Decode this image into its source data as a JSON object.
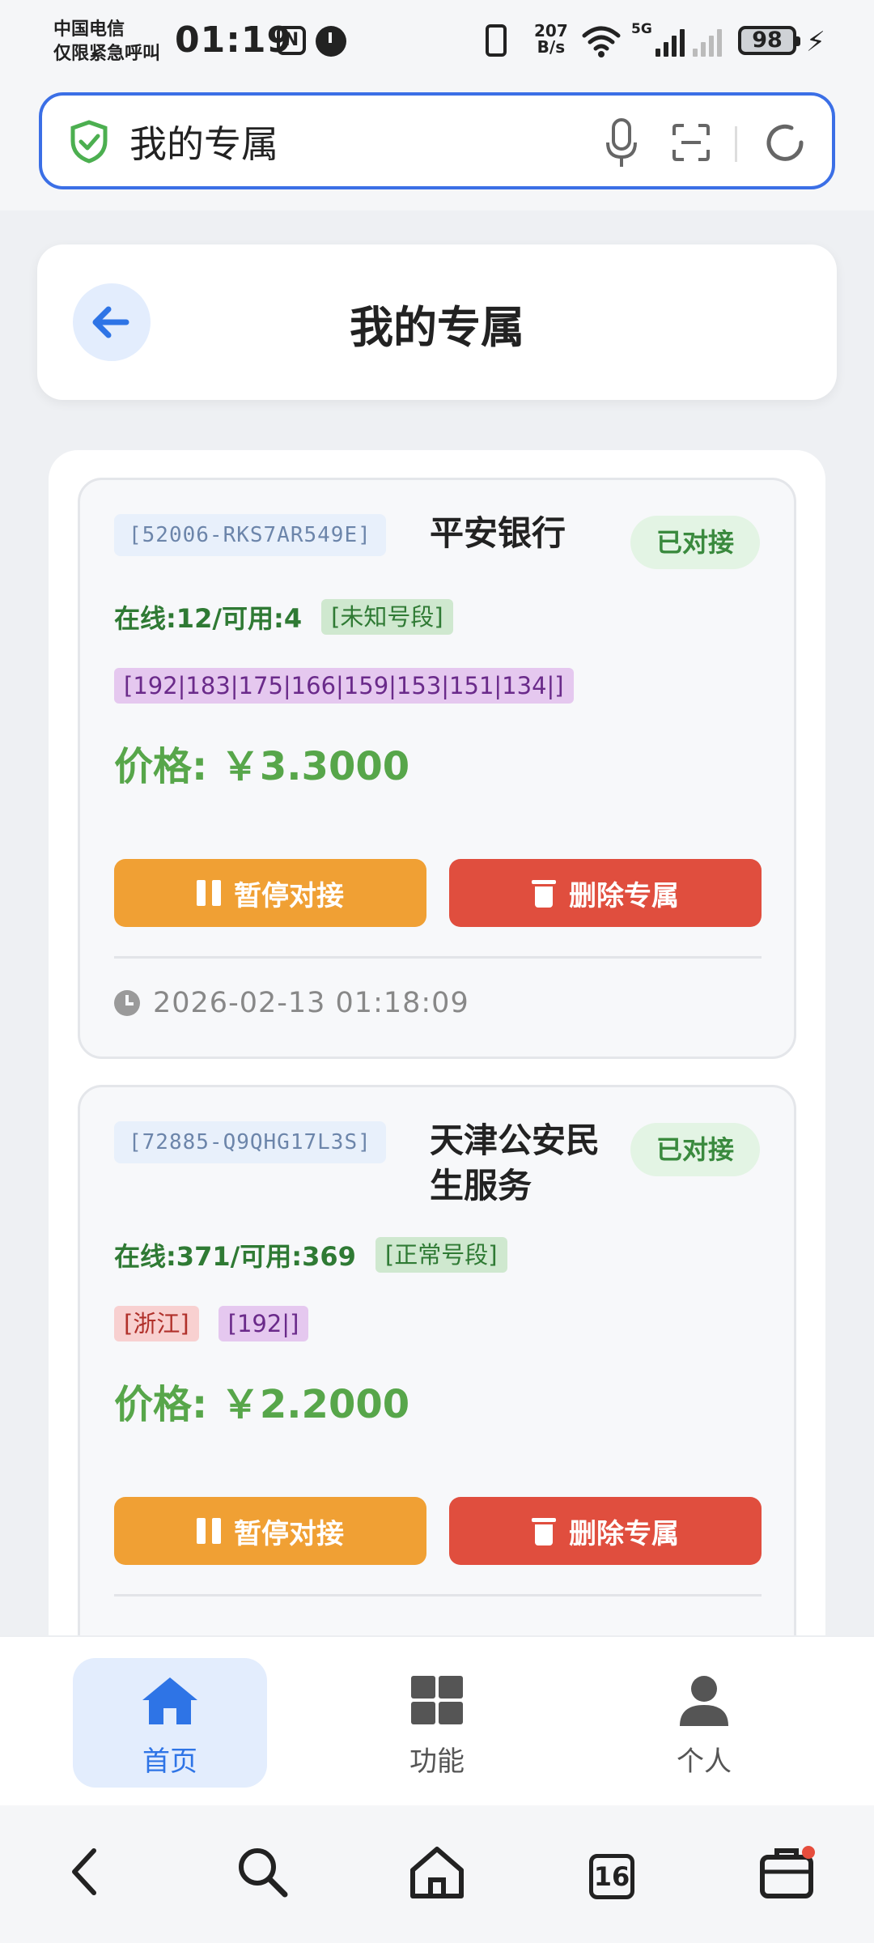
{
  "status_bar": {
    "carrier_line1": "中国电信",
    "carrier_line2": "仅限紧急呼叫",
    "time": "01:19",
    "net_speed_top": "207",
    "net_speed_bottom": "B/s",
    "network_label": "5G",
    "battery": "98"
  },
  "browser": {
    "address_text": "我的专属",
    "tab_count": "16"
  },
  "page": {
    "title": "我的专属"
  },
  "items": [
    {
      "code": "[52006-RKS7AR549E]",
      "name": "平安银行",
      "status": "已对接",
      "stats": "在线:12/可用:4",
      "segment": "[未知号段]",
      "tags_red": [],
      "tags_purple": [
        "[192|183|175|166|159|153|151|134|]"
      ],
      "price": "价格: ￥3.3000",
      "pause_label": "暂停对接",
      "delete_label": "删除专属",
      "time": "2026-02-13 01:18:09"
    },
    {
      "code": "[72885-Q9QHG17L3S]",
      "name": "天津公安民生服务",
      "status": "已对接",
      "stats": "在线:371/可用:369",
      "segment": "[正常号段]",
      "tags_red": [
        "[浙江]"
      ],
      "tags_purple": [
        "[192|]"
      ],
      "price": "价格: ￥2.2000",
      "pause_label": "暂停对接",
      "delete_label": "删除专属"
    }
  ],
  "tabbar": {
    "home": "首页",
    "functions": "功能",
    "profile": "个人"
  },
  "colors": {
    "accent_blue": "#2e74e6",
    "success_green": "#57a64a",
    "pause_orange": "#f0a034",
    "delete_red": "#e04e3e"
  }
}
